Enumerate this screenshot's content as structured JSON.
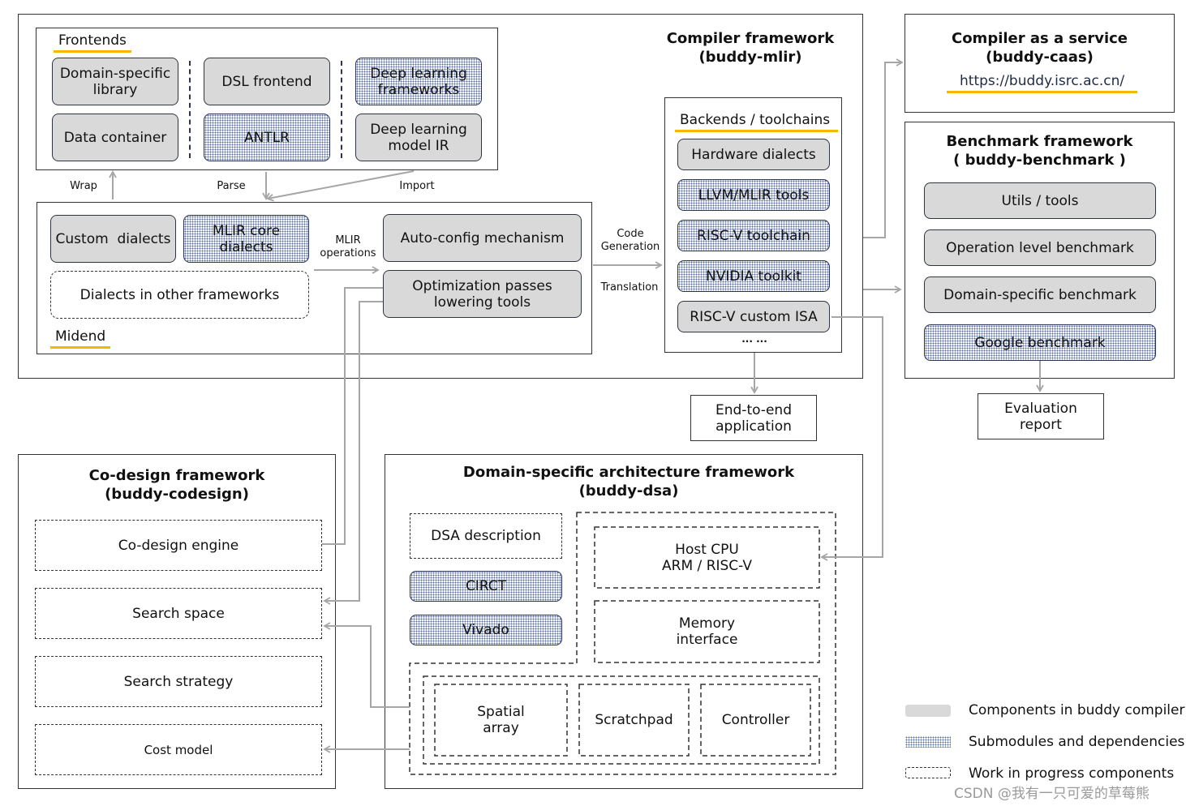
{
  "compiler": {
    "title_line1": "Compiler framework",
    "title_line2": "(buddy-mlir)",
    "frontends": {
      "section_label": "Frontends",
      "items": [
        {
          "label": "Domain-specific library",
          "style": "solid"
        },
        {
          "label": "Data container",
          "style": "solid"
        },
        {
          "label": "DSL frontend",
          "style": "solid"
        },
        {
          "label": "ANTLR",
          "style": "dotted"
        },
        {
          "label": "Deep learning frameworks",
          "style": "dotted"
        },
        {
          "label": "Deep learning model IR",
          "style": "solid"
        }
      ]
    },
    "arrow_labels": {
      "wrap": "Wrap",
      "parse": "Parse",
      "import": "Import",
      "mlir_ops_1": "MLIR",
      "mlir_ops_2": "operations",
      "codegen_1": "Code",
      "codegen_2": "Generation",
      "translation": "Translation"
    },
    "midend": {
      "section_label": "Midend",
      "items": [
        {
          "label": "Custom  dialects",
          "style": "solid"
        },
        {
          "label": "MLIR core dialects",
          "style": "dotted"
        },
        {
          "label": "Dialects in other frameworks",
          "style": "dashed"
        },
        {
          "label": "Auto-config mechanism",
          "style": "solid"
        },
        {
          "label": "Optimization passes lowering tools",
          "style": "solid"
        }
      ]
    },
    "backends": {
      "section_label": "Backends / toolchains",
      "items": [
        {
          "label": "Hardware dialects",
          "style": "solid"
        },
        {
          "label": "LLVM/MLIR tools",
          "style": "dotted"
        },
        {
          "label": "RISC-V toolchain",
          "style": "dotted"
        },
        {
          "label": "NVIDIA toolkit",
          "style": "dotted"
        },
        {
          "label": "RISC-V custom ISA",
          "style": "solid"
        }
      ],
      "ellipsis": "... ..."
    }
  },
  "end_to_end": {
    "line1": "End-to-end",
    "line2": "application"
  },
  "caas": {
    "title_line1": "Compiler as a service",
    "title_line2": "(buddy-caas)",
    "url": "https://buddy.isrc.ac.cn/"
  },
  "benchmark": {
    "title_line1": "Benchmark framework",
    "title_line2": "( buddy-benchmark )",
    "items": [
      {
        "label": "Utils / tools",
        "style": "solid"
      },
      {
        "label": "Operation level benchmark",
        "style": "solid"
      },
      {
        "label": "Domain-specific benchmark",
        "style": "solid"
      },
      {
        "label": "Google benchmark",
        "style": "dotted"
      }
    ]
  },
  "evaluation": {
    "line1": "Evaluation",
    "line2": "report"
  },
  "codesign": {
    "title_line1": "Co-design framework",
    "title_line2": "(buddy-codesign)",
    "items": [
      {
        "label": "Co-design engine"
      },
      {
        "label": "Search space"
      },
      {
        "label": "Search strategy"
      },
      {
        "label": "Cost model"
      }
    ]
  },
  "dsa": {
    "title_line1": "Domain-specific architecture framework",
    "title_line2": "(buddy-dsa)",
    "dsa_description": "DSA description",
    "circt": "CIRCT",
    "vivado": "Vivado",
    "host_cpu_1": "Host CPU",
    "host_cpu_2": "ARM / RISC-V",
    "memory_1": "Memory",
    "memory_2": "interface",
    "spatial_1": "Spatial",
    "spatial_2": "array",
    "scratchpad": "Scratchpad",
    "controller": "Controller"
  },
  "legend": {
    "items": [
      {
        "swatch": "solid",
        "label": "Components in buddy compiler"
      },
      {
        "swatch": "dotted",
        "label": "Submodules and dependencies"
      },
      {
        "swatch": "dashed",
        "label": "Work in progress components"
      }
    ]
  },
  "watermark": "CSDN @我有一只可爱的草莓熊",
  "colors": {
    "accent_underline": "#f5b800",
    "solid_fill": "#d9d9d9",
    "dotted_color": "#5a6d9c",
    "wire": "#a6a6a6"
  }
}
